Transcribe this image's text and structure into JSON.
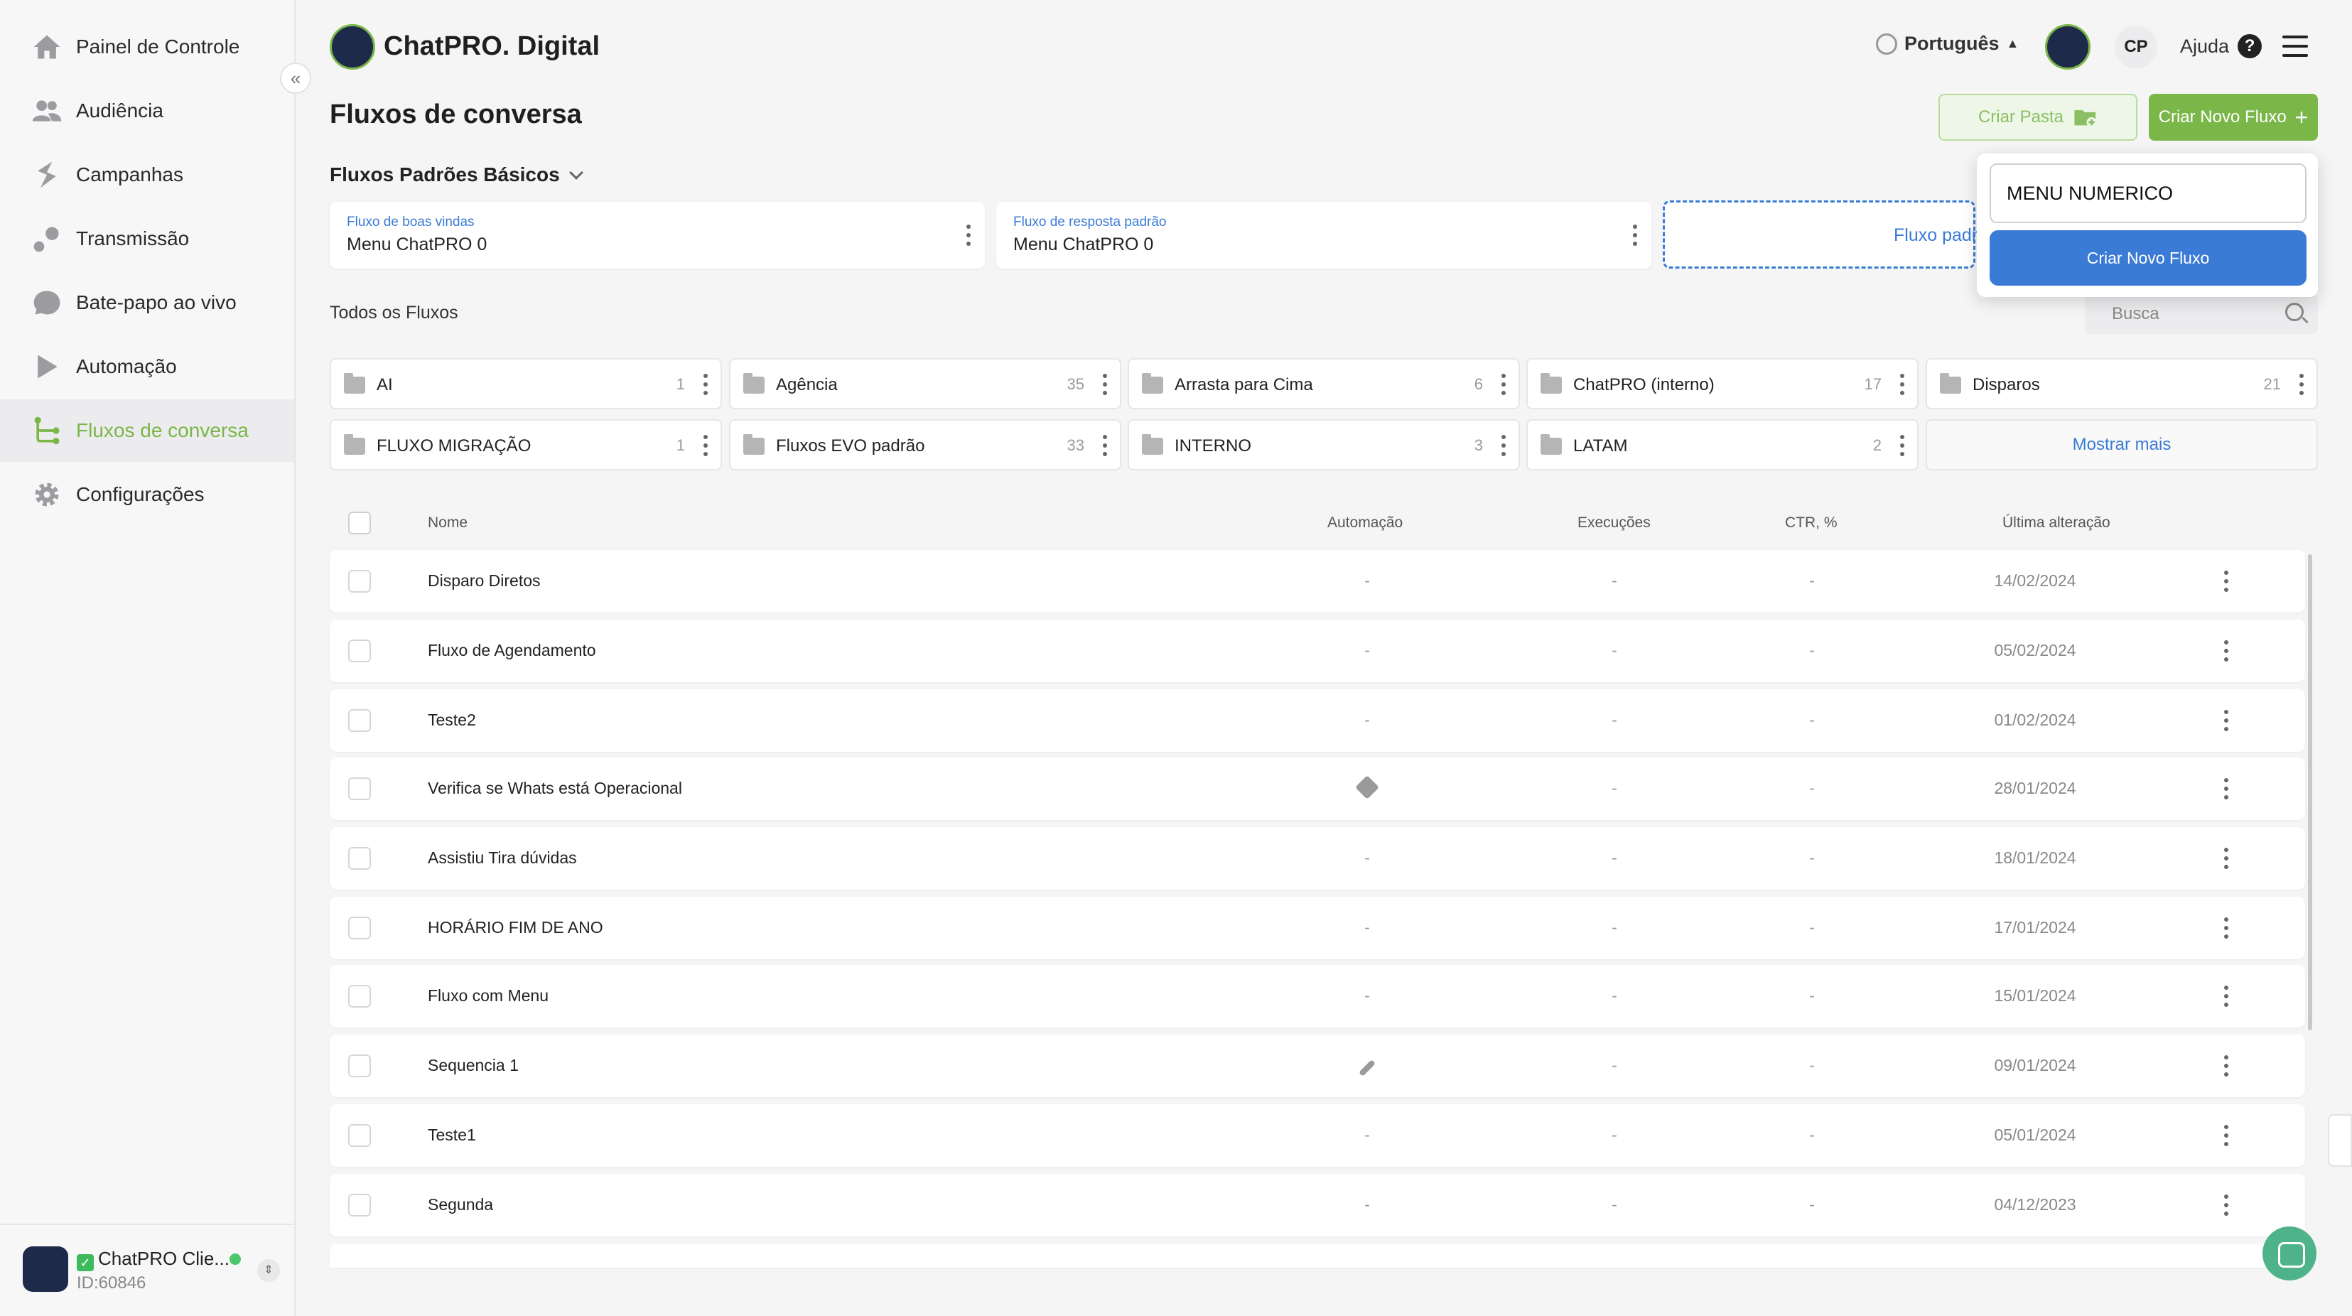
{
  "sidebar": {
    "items": [
      {
        "label": "Painel de Controle",
        "icon": "home-icon"
      },
      {
        "label": "Audiência",
        "icon": "users-icon"
      },
      {
        "label": "Campanhas",
        "icon": "bolt-icon"
      },
      {
        "label": "Transmissão",
        "icon": "broadcast-icon"
      },
      {
        "label": "Bate-papo ao vivo",
        "icon": "chat-bubble-icon"
      },
      {
        "label": "Automação",
        "icon": "play-icon"
      },
      {
        "label": "Fluxos de conversa",
        "icon": "flow-icon"
      },
      {
        "label": "Configurações",
        "icon": "gear-icon"
      }
    ],
    "active": "Fluxos de conversa",
    "account": {
      "name": "ChatPRO Clie...",
      "id": "ID:60846"
    }
  },
  "header": {
    "brand": "ChatPRO. Digital",
    "language": "Português",
    "initials": "CP",
    "help": "Ajuda"
  },
  "page": {
    "title": "Fluxos de conversa",
    "create_folder": "Criar Pasta",
    "create_flow": "Criar Novo Fluxo"
  },
  "basic": {
    "title": "Fluxos Padrões Básicos",
    "cards": [
      {
        "label": "Fluxo de boas vindas",
        "value": "Menu ChatPRO 0"
      },
      {
        "label": "Fluxo de resposta padrão",
        "value": "Menu ChatPRO 0"
      }
    ],
    "dashed_label": "Fluxo padr"
  },
  "all": {
    "title": "Todos os Fluxos",
    "search_placeholder": "Busca"
  },
  "folders": [
    {
      "name": "AI",
      "count": "1"
    },
    {
      "name": "Agência",
      "count": "35"
    },
    {
      "name": "Arrasta para Cima",
      "count": "6"
    },
    {
      "name": "ChatPRO (interno)",
      "count": "17"
    },
    {
      "name": "Disparos",
      "count": "21"
    },
    {
      "name": "FLUXO MIGRAÇÃO",
      "count": "1"
    },
    {
      "name": "Fluxos EVO padrão",
      "count": "33"
    },
    {
      "name": "INTERNO",
      "count": "3"
    },
    {
      "name": "LATAM",
      "count": "2"
    }
  ],
  "show_more": "Mostrar mais",
  "table": {
    "headers": {
      "name": "Nome",
      "automation": "Automação",
      "runs": "Execuções",
      "ctr": "CTR, %",
      "last": "Última alteração"
    },
    "rows": [
      {
        "name": "Disparo Diretos",
        "automation": "-",
        "runs": "-",
        "ctr": "-",
        "date": "14/02/2024"
      },
      {
        "name": "Fluxo de Agendamento",
        "automation": "-",
        "runs": "-",
        "ctr": "-",
        "date": "05/02/2024"
      },
      {
        "name": "Teste2",
        "automation": "-",
        "runs": "-",
        "ctr": "-",
        "date": "01/02/2024"
      },
      {
        "name": "Verifica se Whats está Operacional",
        "automation": "",
        "automation_icon": "tag-icon",
        "runs": "-",
        "ctr": "-",
        "date": "28/01/2024"
      },
      {
        "name": "Assistiu Tira dúvidas",
        "automation": "-",
        "runs": "-",
        "ctr": "-",
        "date": "18/01/2024"
      },
      {
        "name": "HORÁRIO FIM DE ANO",
        "automation": "-",
        "runs": "-",
        "ctr": "-",
        "date": "17/01/2024"
      },
      {
        "name": "Fluxo com Menu",
        "automation": "-",
        "runs": "-",
        "ctr": "-",
        "date": "15/01/2024"
      },
      {
        "name": "Sequencia 1",
        "automation": "",
        "automation_icon": "link-icon",
        "runs": "-",
        "ctr": "-",
        "date": "09/01/2024"
      },
      {
        "name": "Teste1",
        "automation": "-",
        "runs": "-",
        "ctr": "-",
        "date": "05/01/2024"
      },
      {
        "name": "Segunda",
        "automation": "-",
        "runs": "-",
        "ctr": "-",
        "date": "04/12/2023"
      }
    ]
  },
  "popover": {
    "input_value": "MENU NUMERICO",
    "button": "Criar Novo Fluxo"
  },
  "colors": {
    "accent": "#7ab648",
    "primary": "#3a7bd5",
    "background": "#f5f5f6"
  }
}
